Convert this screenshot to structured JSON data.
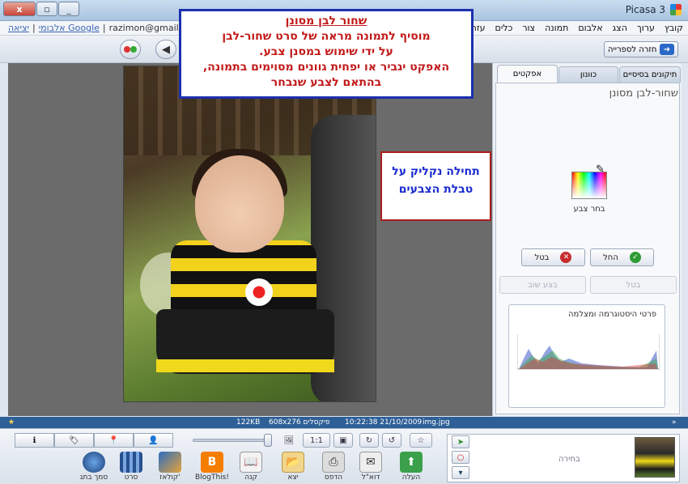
{
  "window": {
    "app_title": "Picasa 3",
    "close_label": "x",
    "restore_label": "▫",
    "minimize_label": "_"
  },
  "menu": [
    "קובץ",
    "ערוך",
    "הצג",
    "אלבום",
    "תמונה",
    "צור",
    "כלים",
    "עזרה"
  ],
  "account": {
    "sign_out": "יציאה",
    "google_albums": "אלבומי Google",
    "email": "razimon@gmail.com"
  },
  "toolbar": {
    "back_to_library": "חזרה לספרייה"
  },
  "annotation_main": {
    "title": "שחור לבן מסונן",
    "line1": "מוסיף לתמונה מראה של סרט שחור-לבן",
    "line2": "על ידי שימוש במסנן צבע.",
    "line3": "האפקט יגביר או יפחית גוונים מסוימים בתמונה,",
    "line4": "בהתאם לצבע שנבחר"
  },
  "annotation_callout": {
    "line1": "תחילה נקליק על",
    "line2": "טבלת הצבעים"
  },
  "panel": {
    "tabs": [
      "תיקונים בסיסיים",
      "כוונון",
      "אפקטים"
    ],
    "active_tab": "אפקטים",
    "effect_title": "שחור-לבן מסונן",
    "pick_color_label": "בחר צבע",
    "apply_label": "החל",
    "cancel_label": "בטל",
    "undo_label": "בטל",
    "redo_label": "בצע שוב",
    "histogram_title": "פרטי היסטוגרמה ומצלמה"
  },
  "status": {
    "file_size": "122KB",
    "dimensions": "608x276 פיקסלים",
    "datetime": "10:22:38 21/10/2009",
    "filename": "img.jpg"
  },
  "bottom": {
    "selection_label": "בחירה",
    "tools": [
      "העלה",
      "דוא\"ל",
      "הדפס",
      "יצא",
      "קנה",
      "BlogThis!",
      "קולאז'",
      "סרט",
      "סמך בתג"
    ]
  },
  "colors": {
    "annotation_border": "#1b2fae",
    "annotation_text": "#c21a1a",
    "callout_border": "#a81d1d",
    "callout_text": "#1a2bd0",
    "status_bar": "#2e5f97"
  }
}
